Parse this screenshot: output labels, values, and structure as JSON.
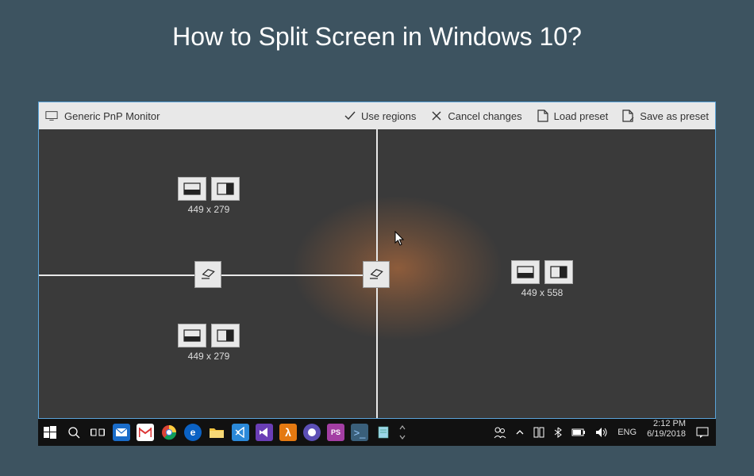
{
  "page_title": "How to Split Screen in Windows 10?",
  "toolbar": {
    "monitor_label": "Generic PnP Monitor",
    "use_regions": "Use regions",
    "cancel_changes": "Cancel changes",
    "load_preset": "Load preset",
    "save_preset": "Save as preset"
  },
  "regions": [
    {
      "id": "top-left",
      "size_label": "449 x 279"
    },
    {
      "id": "bottom-left",
      "size_label": "449 x 279"
    },
    {
      "id": "right",
      "size_label": "449 x 558"
    }
  ],
  "taskbar": {
    "language": "ENG",
    "time": "2:12 PM",
    "date": "6/19/2018"
  }
}
